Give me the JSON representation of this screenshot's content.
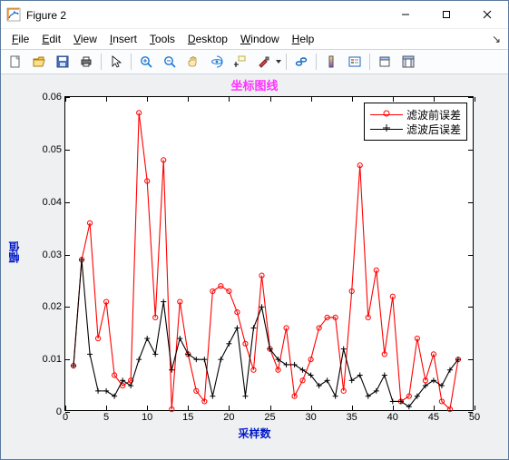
{
  "window": {
    "title": "Figure 2"
  },
  "menu": {
    "file": {
      "u": "F",
      "rest": "ile"
    },
    "edit": {
      "u": "E",
      "rest": "dit"
    },
    "view": {
      "u": "V",
      "rest": "iew"
    },
    "insert": {
      "u": "I",
      "rest": "nsert"
    },
    "tools": {
      "u": "T",
      "rest": "ools"
    },
    "desktop": {
      "u": "D",
      "rest": "esktop"
    },
    "window": {
      "u": "W",
      "rest": "indow"
    },
    "help": {
      "u": "H",
      "rest": "elp"
    }
  },
  "chart_data": {
    "type": "line",
    "title": "坐标图线",
    "xlabel": "采样数",
    "ylabel": "幅值",
    "xlim": [
      0,
      50
    ],
    "ylim": [
      0,
      0.06
    ],
    "xticks": [
      0,
      5,
      10,
      15,
      20,
      25,
      30,
      35,
      40,
      45,
      50
    ],
    "yticks": [
      0,
      0.01,
      0.02,
      0.03,
      0.04,
      0.05,
      0.06
    ],
    "series": [
      {
        "name": "滤波前误差",
        "color": "#ff0000",
        "marker": "o",
        "x": [
          1,
          2,
          3,
          4,
          5,
          6,
          7,
          8,
          9,
          10,
          11,
          12,
          13,
          14,
          15,
          16,
          17,
          18,
          19,
          20,
          21,
          22,
          23,
          24,
          25,
          26,
          27,
          28,
          29,
          30,
          31,
          32,
          33,
          34,
          35,
          36,
          37,
          38,
          39,
          40,
          41,
          42,
          43,
          44,
          45,
          46,
          47,
          48
        ],
        "y": [
          0.0088,
          0.029,
          0.036,
          0.014,
          0.021,
          0.007,
          0.005,
          0.006,
          0.057,
          0.044,
          0.018,
          0.048,
          0.0005,
          0.021,
          0.011,
          0.004,
          0.002,
          0.023,
          0.024,
          0.023,
          0.019,
          0.013,
          0.008,
          0.026,
          0.012,
          0.008,
          0.016,
          0.003,
          0.006,
          0.01,
          0.016,
          0.018,
          0.018,
          0.004,
          0.023,
          0.047,
          0.018,
          0.027,
          0.011,
          0.022,
          0.002,
          0.003,
          0.014,
          0.006,
          0.011,
          0.002,
          0.0005,
          0.01
        ]
      },
      {
        "name": "滤波后误差",
        "color": "#000000",
        "marker": "+",
        "x": [
          1,
          2,
          3,
          4,
          5,
          6,
          7,
          8,
          9,
          10,
          11,
          12,
          13,
          14,
          15,
          16,
          17,
          18,
          19,
          20,
          21,
          22,
          23,
          24,
          25,
          26,
          27,
          28,
          29,
          30,
          31,
          32,
          33,
          34,
          35,
          36,
          37,
          38,
          39,
          40,
          41,
          42,
          43,
          44,
          45,
          46,
          47,
          48
        ],
        "y": [
          0.0088,
          0.029,
          0.011,
          0.004,
          0.004,
          0.003,
          0.006,
          0.005,
          0.01,
          0.014,
          0.011,
          0.021,
          0.008,
          0.014,
          0.011,
          0.01,
          0.01,
          0.003,
          0.01,
          0.013,
          0.016,
          0.003,
          0.016,
          0.02,
          0.012,
          0.01,
          0.009,
          0.009,
          0.008,
          0.007,
          0.005,
          0.006,
          0.003,
          0.012,
          0.006,
          0.007,
          0.003,
          0.004,
          0.007,
          0.002,
          0.002,
          0.001,
          0.003,
          0.005,
          0.006,
          0.005,
          0.008,
          0.01
        ]
      }
    ],
    "legend_pos": "ne"
  }
}
